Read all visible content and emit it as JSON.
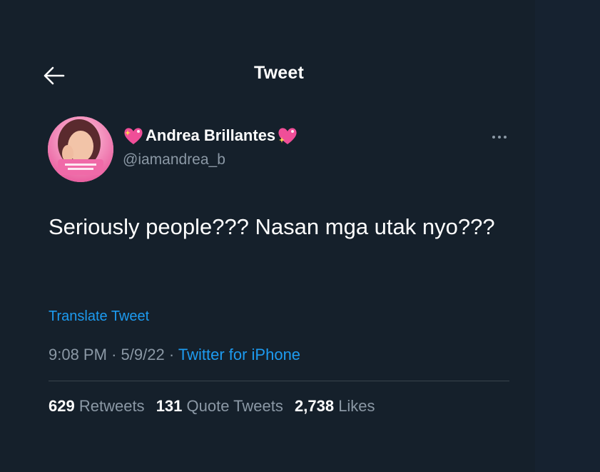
{
  "header": {
    "title": "Tweet",
    "back_icon": "arrow-left-icon"
  },
  "author": {
    "display_name": "Andrea Brillantes",
    "handle": "@iamandrea_b",
    "name_emoji_icon": "sparkling-heart-icon",
    "avatar_icon": "avatar-image"
  },
  "tweet": {
    "text": "Seriously people??? Nasan mga utak nyo???",
    "translate_label": "Translate Tweet"
  },
  "meta": {
    "time": "9:08 PM",
    "separator": "·",
    "date": "5/9/22",
    "source": "Twitter for iPhone"
  },
  "stats": {
    "retweets_count": "629",
    "retweets_label": "Retweets",
    "quotes_count": "131",
    "quotes_label": "Quote Tweets",
    "likes_count": "2,738",
    "likes_label": "Likes"
  },
  "colors": {
    "background": "#15202b",
    "link": "#1d9bf0",
    "secondary_text": "#8b98a5",
    "divider": "#38444d"
  }
}
